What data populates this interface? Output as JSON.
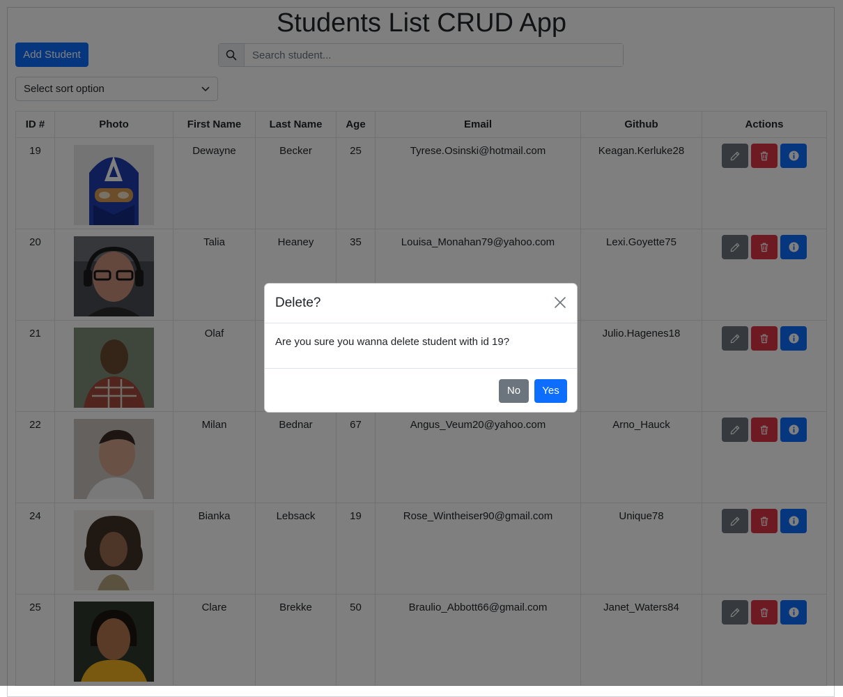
{
  "header": {
    "title": "Students List CRUD App"
  },
  "toolbar": {
    "add_label": "Add Student",
    "search_placeholder": "Search student...",
    "search_value": "",
    "sort_selected": "Select sort option"
  },
  "table": {
    "columns": [
      "ID #",
      "Photo",
      "First Name",
      "Last Name",
      "Age",
      "Email",
      "Github",
      "Actions"
    ],
    "rows": [
      {
        "id": "19",
        "first": "Dewayne",
        "last": "Becker",
        "age": "25",
        "email": "Tyrese.Osinski@hotmail.com",
        "github": "Keagan.Kerluke28"
      },
      {
        "id": "20",
        "first": "Talia",
        "last": "Heaney",
        "age": "35",
        "email": "Louisa_Monahan79@yahoo.com",
        "github": "Lexi.Goyette75"
      },
      {
        "id": "21",
        "first": "Olaf",
        "last": "",
        "age": "",
        "email": "",
        "github": "Julio.Hagenes18"
      },
      {
        "id": "22",
        "first": "Milan",
        "last": "Bednar",
        "age": "67",
        "email": "Angus_Veum20@yahoo.com",
        "github": "Arno_Hauck"
      },
      {
        "id": "24",
        "first": "Bianka",
        "last": "Lebsack",
        "age": "19",
        "email": "Rose_Wintheiser90@gmail.com",
        "github": "Unique78"
      },
      {
        "id": "25",
        "first": "Clare",
        "last": "Brekke",
        "age": "50",
        "email": "Braulio_Abbott66@gmail.com",
        "github": "Janet_Waters84"
      }
    ]
  },
  "modal": {
    "title": "Delete?",
    "body": "Are you sure you wanna delete student with id 19?",
    "no_label": "No",
    "yes_label": "Yes"
  },
  "icons": {
    "search": "search-icon",
    "chevron": "chevron-down-icon",
    "edit": "pencil-icon",
    "delete": "trash-icon",
    "info": "info-icon",
    "close": "close-icon"
  },
  "colors": {
    "primary": "#0d6efd",
    "secondary": "#6c757d",
    "danger": "#dc3545",
    "backdrop": "rgba(0,0,0,0.5)"
  }
}
